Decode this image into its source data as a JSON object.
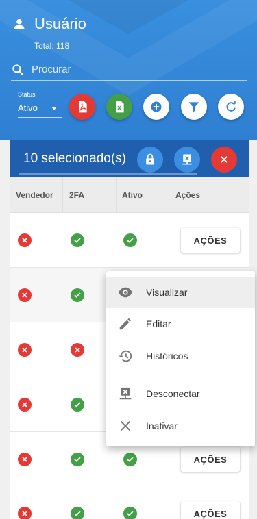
{
  "header": {
    "title": "Usuário",
    "total": "Total: 118",
    "search_placeholder": "Procurar",
    "status_label": "Status",
    "status_value": "Ativo",
    "colors": {
      "primary": "#2f7fd2",
      "pdf": "#e53935",
      "excel": "#43a047"
    }
  },
  "actions": {
    "pdf_icon": "pdf-icon",
    "excel_icon": "excel-icon",
    "add_icon": "add-icon",
    "filter_icon": "filter-icon",
    "refresh_icon": "refresh-icon"
  },
  "selection": {
    "text": "10 selecionado(s)",
    "color": "#1f5fae"
  },
  "table": {
    "headers": [
      "Vendedor",
      "2FA",
      "Ativo",
      "Ações"
    ],
    "action_label": "AÇÕES",
    "rows": [
      {
        "vendedor": "no",
        "twofa": "yes",
        "ativo": "yes",
        "show_button": true
      },
      {
        "vendedor": "no",
        "twofa": "yes",
        "ativo": "",
        "show_button": false
      },
      {
        "vendedor": "no",
        "twofa": "no",
        "ativo": "",
        "show_button": false
      },
      {
        "vendedor": "no",
        "twofa": "yes",
        "ativo": "",
        "show_button": false
      },
      {
        "vendedor": "no",
        "twofa": "yes",
        "ativo": "yes",
        "show_button": true
      },
      {
        "vendedor": "no",
        "twofa": "yes",
        "ativo": "yes",
        "show_button": true
      }
    ]
  },
  "menu": {
    "items": [
      {
        "label": "Visualizar",
        "icon": "eye-icon"
      },
      {
        "label": "Editar",
        "icon": "pencil-icon"
      },
      {
        "label": "Históricos",
        "icon": "history-icon"
      },
      {
        "label": "Desconectar",
        "icon": "disconnect-icon"
      },
      {
        "label": "Inativar",
        "icon": "close-icon"
      }
    ]
  }
}
